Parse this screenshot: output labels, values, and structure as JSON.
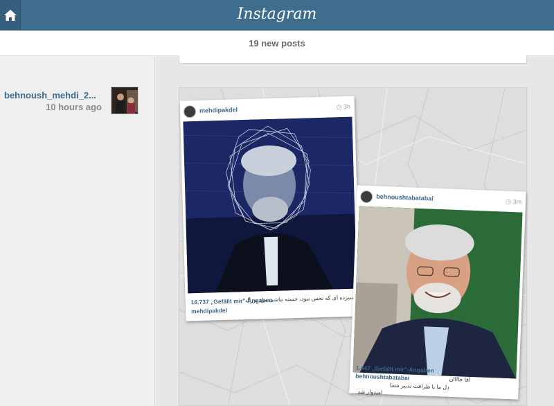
{
  "app": {
    "brand": "Instagram"
  },
  "new_posts": {
    "label": "19 new posts"
  },
  "post": {
    "author": "behnoush_mehdi_2...",
    "time": "10 hours ago"
  },
  "screenshots": [
    {
      "username": "mehdipakdel",
      "time": "3h",
      "likes": "16.737 „Gefällt mir\"-Angaben",
      "caption_user": "mehdipakdel",
      "caption_text": "سیزده ای که نحس نبود، خسته نباشی مرد بزرگ"
    },
    {
      "username": "behnoushtabatabai",
      "time": "3m",
      "likes": "1.447 „Gefällt mir\"-Angaben",
      "caption_user": "behnoushtabatabai",
      "caption_text_1": "آقا جاااان",
      "caption_text_2": "دل ما با ظرافت تدبیر شما",
      "caption_text_3": "امیدوار شد"
    }
  ],
  "colors": {
    "topbar": "#3f6d8e",
    "link": "#3b6a8e"
  },
  "icons": [
    "home-icon",
    "clock-icon"
  ]
}
